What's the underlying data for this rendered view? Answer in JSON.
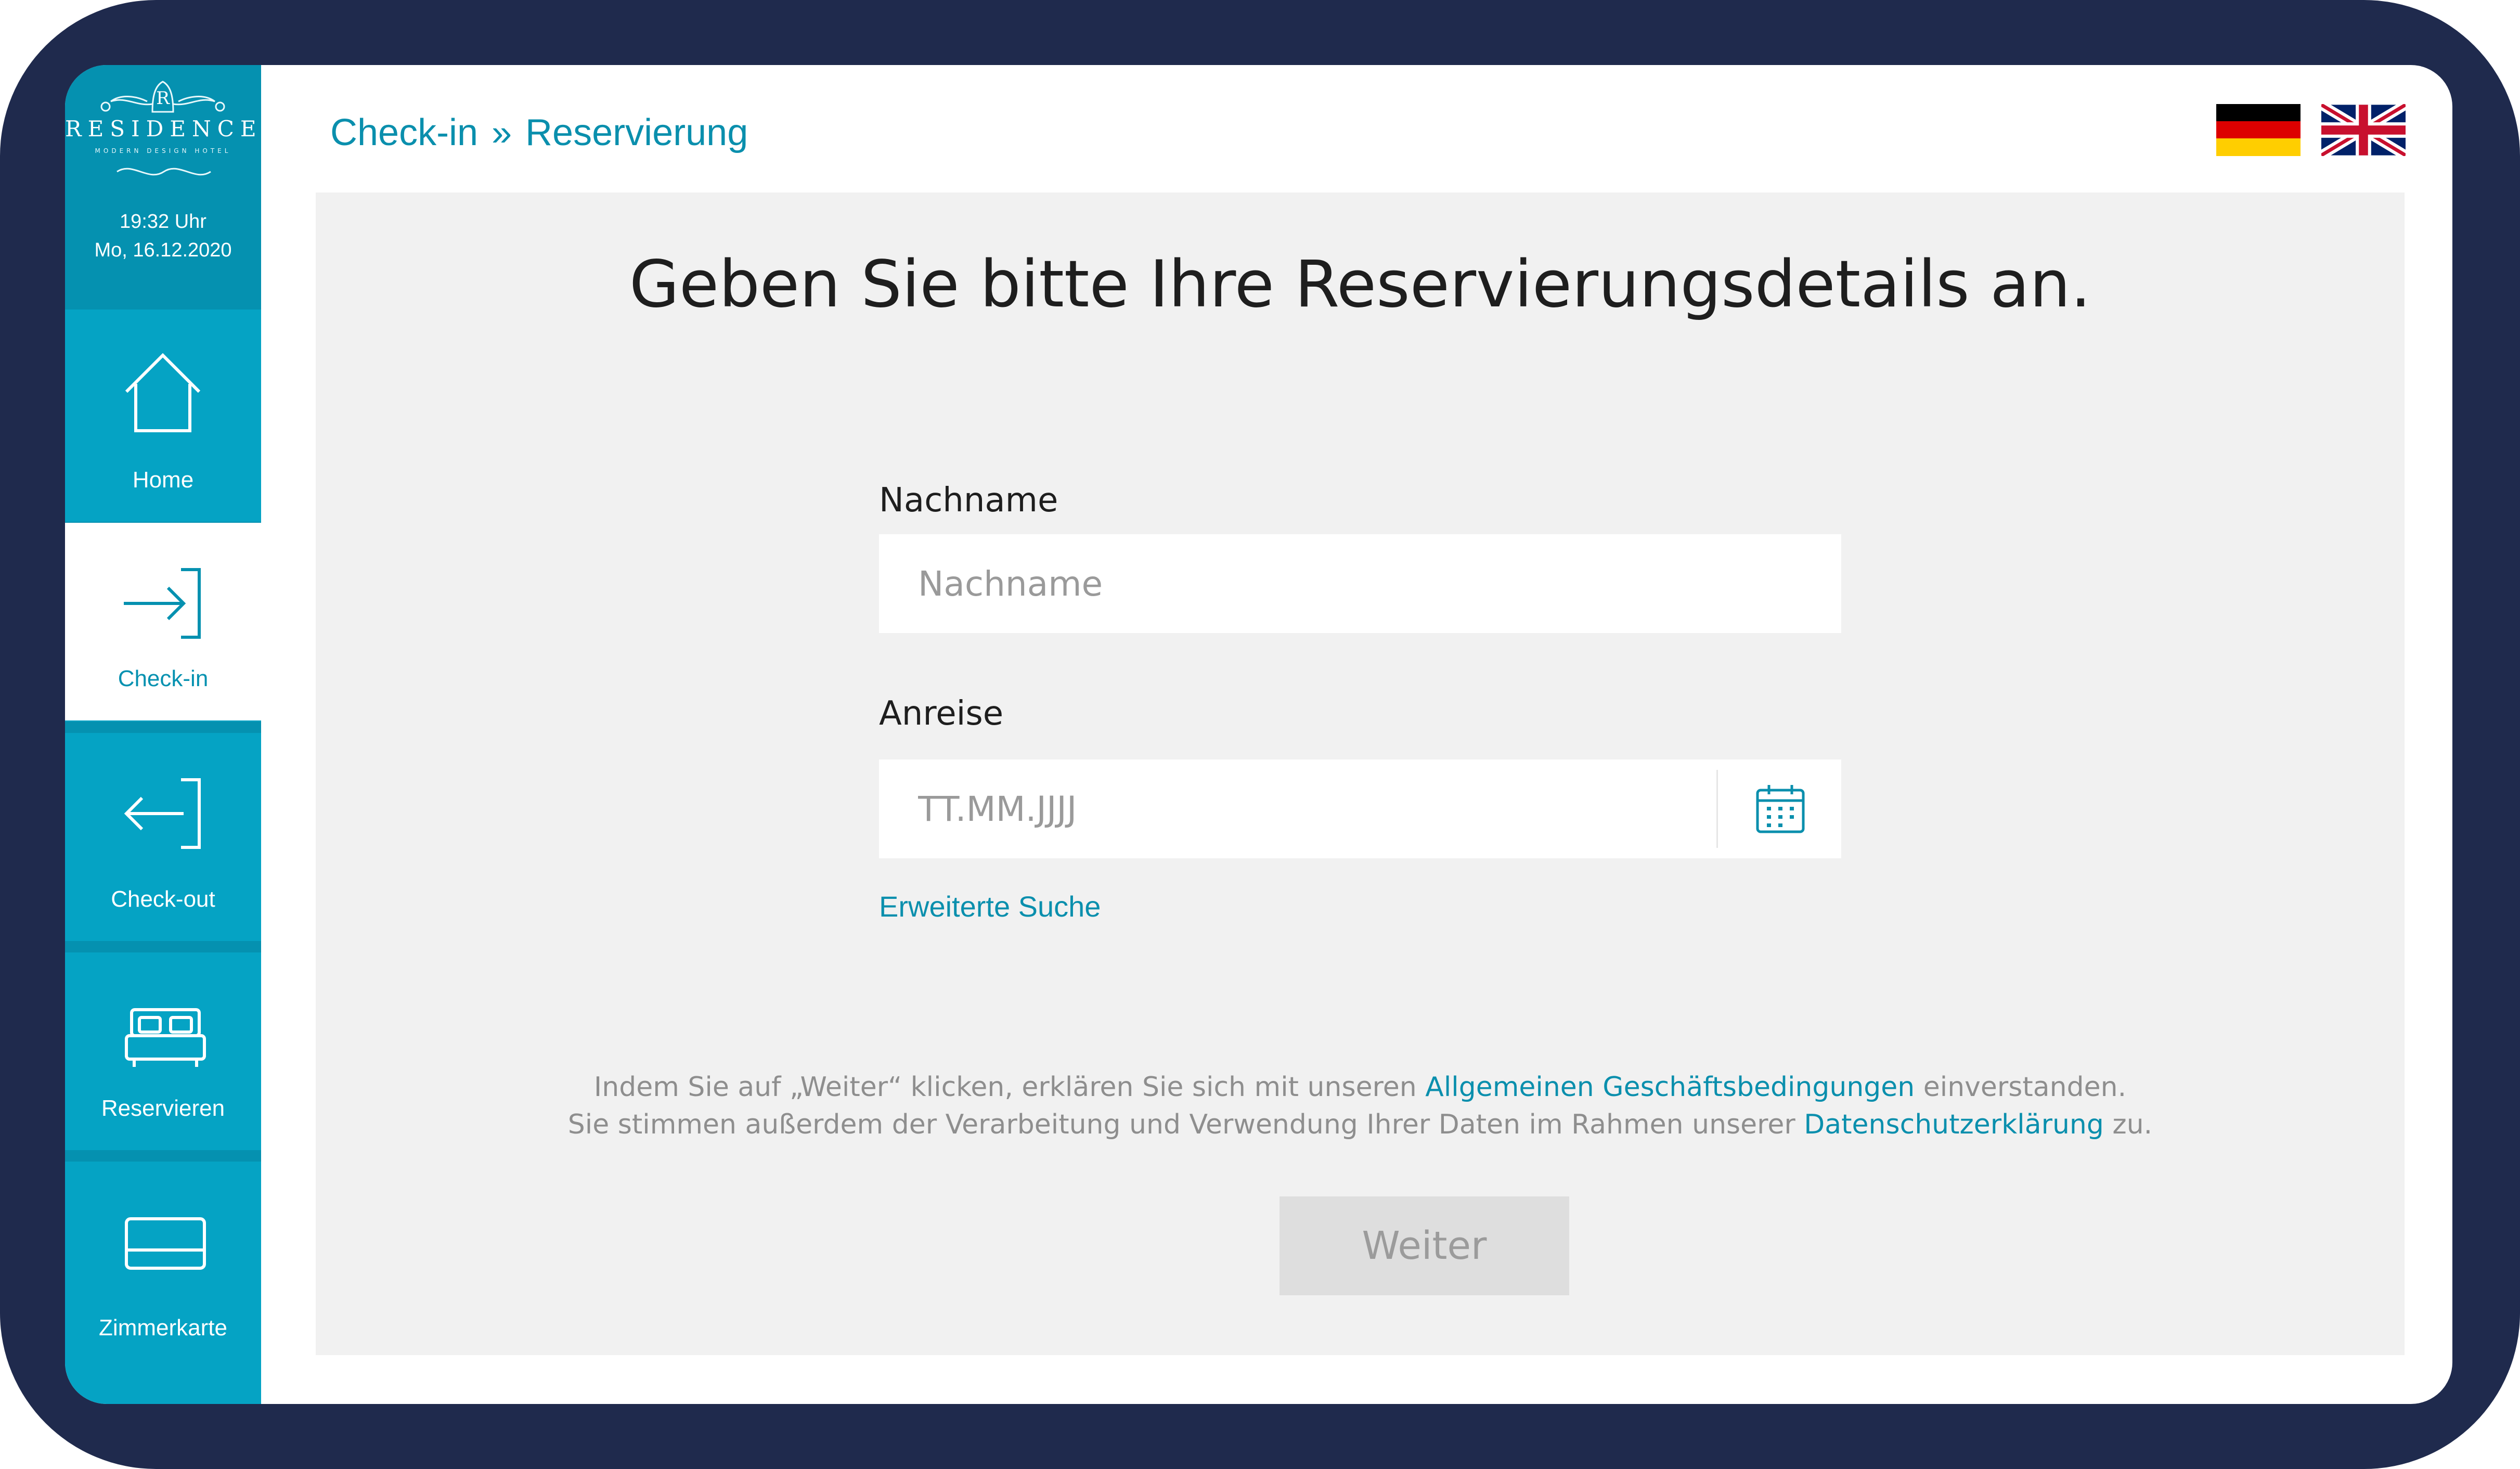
{
  "sidebar": {
    "logo": {
      "name": "RESIDENCE",
      "tagline": "MODERN DESIGN HOTEL",
      "emblem": "R"
    },
    "time": "19:32 Uhr",
    "date": "Mo, 16.12.2020",
    "items": [
      {
        "label": "Home",
        "icon": "home-icon"
      },
      {
        "label": "Check-in",
        "icon": "check-in-icon",
        "active": true
      },
      {
        "label": "Check-out",
        "icon": "check-out-icon"
      },
      {
        "label": "Reservieren",
        "icon": "bed-icon"
      },
      {
        "label": "Zimmerkarte",
        "icon": "room-card-icon"
      }
    ]
  },
  "header": {
    "breadcrumb": [
      "Check-in",
      "Reservierung"
    ],
    "breadcrumb_separator": "»",
    "languages": [
      "de",
      "en"
    ]
  },
  "form": {
    "headline": "Geben Sie bitte Ihre Reservierungsdetails an.",
    "lastname_label": "Nachname",
    "lastname_placeholder": "Nachname",
    "arrival_label": "Anreise",
    "arrival_placeholder": "TT.MM.JJJJ",
    "advanced_search": "Erweiterte Suche"
  },
  "legal": {
    "line1_pre": "Indem Sie auf „Weiter“ klicken, erklären Sie sich mit unseren ",
    "line1_link": "Allgemeinen Geschäftsbedingungen",
    "line1_post": " einverstanden.",
    "line2_pre": "Sie stimmen außerdem der Verarbeitung und Verwendung Ihrer Daten im Rahmen unserer ",
    "line2_link": "Datenschutzerklärung",
    "line2_post": " zu."
  },
  "actions": {
    "continue": "Weiter"
  },
  "colors": {
    "frame": "#1f2a4d",
    "sidebar": "#05a3c4",
    "sidebar_dark": "#0591b0",
    "accent_text": "#0a8fad",
    "panel": "#f1f1f1",
    "button_disabled": "#dedede"
  }
}
